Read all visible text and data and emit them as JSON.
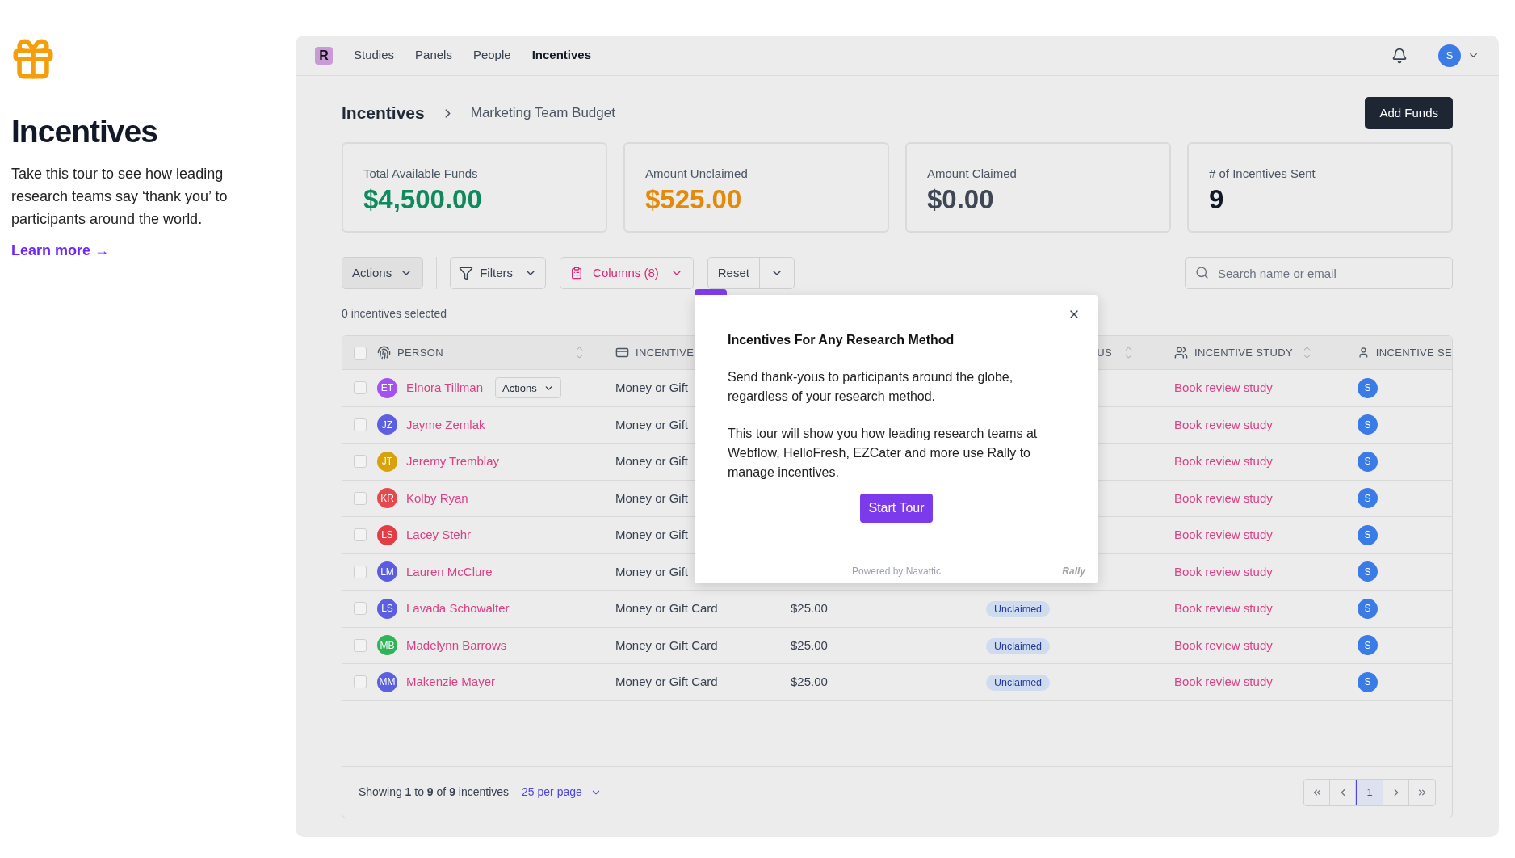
{
  "intro": {
    "title": "Incentives",
    "text": "Take this tour to see how leading research teams say ‘thank you’ to participants around the world.",
    "link": "Learn more →"
  },
  "app": {
    "logo": "R",
    "nav": [
      {
        "label": "Studies",
        "selected": false
      },
      {
        "label": "Panels",
        "selected": false
      },
      {
        "label": "People",
        "selected": false
      },
      {
        "label": "Incentives",
        "selected": true
      }
    ],
    "user_initial": "S"
  },
  "breadcrumb": [
    "Incentives",
    "Marketing Team Budget"
  ],
  "add_funds": "Add Funds",
  "stats": [
    {
      "label": "Total Available Funds",
      "value": "$4,500.00",
      "color": "#0f8a5f"
    },
    {
      "label": "Amount Unclaimed",
      "value": "$525.00",
      "color": "#e38a0a"
    },
    {
      "label": "Amount Claimed",
      "value": "$0.00",
      "color": "#3f4654"
    },
    {
      "label": "# of Incentives Sent",
      "value": "9",
      "color": "#111827"
    }
  ],
  "toolbar": {
    "actions": "Actions",
    "filters": "Filters",
    "columns": "Columns (8)",
    "reset": "Reset",
    "search": {
      "placeholder": "Search name or email"
    }
  },
  "selected_count": "0 incentives selected",
  "table": {
    "select_all": {
      "checked": false
    },
    "columns": [
      "PERSON",
      "INCENTIVE",
      "US",
      "INCENTIVE STUDY",
      "INCENTIVE SE"
    ],
    "row_actions": "Actions",
    "rows": [
      {
        "checked": false,
        "initials": "ET",
        "color": "#a550f0",
        "name": "Elnora Tillman",
        "incentive": "Money or Gift",
        "study": "Book review study",
        "sender": "S"
      },
      {
        "checked": false,
        "initials": "JZ",
        "color": "#5b5fe0",
        "name": "Jayme Zemlak",
        "incentive": "Money or Gift",
        "study": "Book review study",
        "sender": "S"
      },
      {
        "checked": false,
        "initials": "JT",
        "color": "#d9a20c",
        "name": "Jeremy Tremblay",
        "incentive": "Money or Gift",
        "study": "Book review study",
        "sender": "S"
      },
      {
        "checked": false,
        "initials": "KR",
        "color": "#e5484d",
        "name": "Kolby Ryan",
        "incentive": "Money or Gift",
        "study": "Book review study",
        "sender": "S"
      },
      {
        "checked": false,
        "initials": "LS",
        "color": "#e23d45",
        "name": "Lacey Stehr",
        "incentive": "Money or Gift",
        "study": "Book review study",
        "sender": "S"
      },
      {
        "checked": false,
        "initials": "LM",
        "color": "#5a5de1",
        "name": "Lauren McClure",
        "incentive": "Money or Gift",
        "study": "Book review study",
        "sender": "S"
      },
      {
        "checked": false,
        "initials": "LS",
        "color": "#5b5fdf",
        "name": "Lavada Schowalter",
        "incentive": "Money or Gift Card",
        "amount": "$25.00",
        "status": "Unclaimed",
        "study": "Book review study",
        "sender": "S"
      },
      {
        "checked": false,
        "initials": "MB",
        "color": "#2fb457",
        "name": "Madelynn Barrows",
        "incentive": "Money or Gift Card",
        "amount": "$25.00",
        "status": "Unclaimed",
        "study": "Book review study",
        "sender": "S"
      },
      {
        "checked": false,
        "initials": "MM",
        "color": "#5b5fe0",
        "name": "Makenzie Mayer",
        "incentive": "Money or Gift Card",
        "amount": "$25.00",
        "status": "Unclaimed",
        "study": "Book review study",
        "sender": "S"
      }
    ]
  },
  "footer": {
    "showing": "Showing **1** to **9** of **9** incentives",
    "per_page": "25 per page",
    "pages": [
      {
        "label": "1",
        "selected": true
      }
    ]
  },
  "popover": {
    "progress": {
      "level": 0.08
    },
    "title": "Incentives For Any Research Method",
    "paragraphs": [
      "Send thank-yous to participants around the globe, regardless of your research method.",
      "This tour will show you how leading research teams at Webflow, HelloFresh, EZCater and more use Rally to manage incentives."
    ],
    "button": "Start Tour",
    "powered_by": "Powered by Navattic",
    "brand": "Rally"
  }
}
